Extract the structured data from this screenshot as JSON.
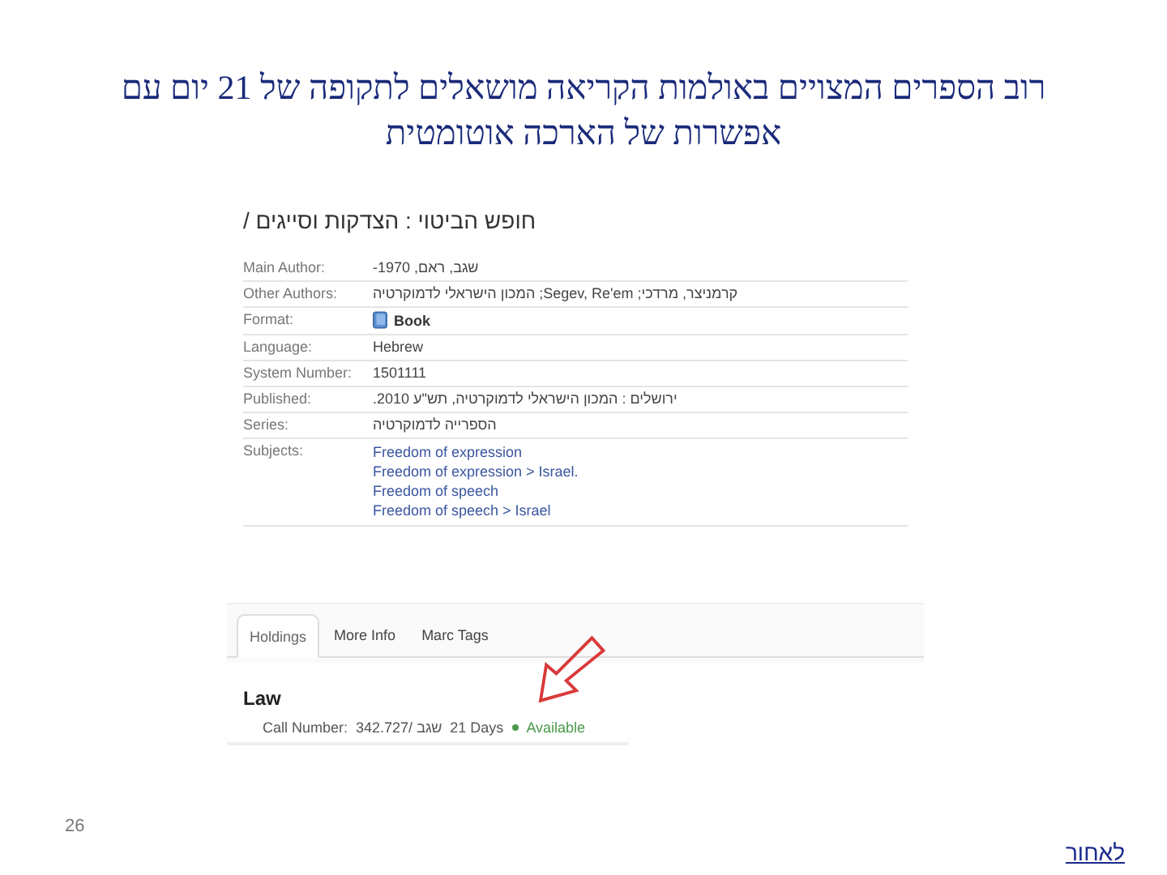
{
  "slide": {
    "title": "רוב הספרים המצויים באולמות הקריאה מושאלים לתקופה של 21 יום עם אפשרות של הארכה אוטומטית",
    "page_number": "26",
    "back_link": "לאחור"
  },
  "record": {
    "title": "חופש הביטוי : הצדקות וסייגים /",
    "fields": [
      {
        "label": "Main Author:",
        "kind": "text",
        "values": [
          "שגב, ראם, 1970-"
        ]
      },
      {
        "label": "Other Authors:",
        "kind": "text",
        "values": [
          "קרמניצר, מרדכי; Segev, Re'em; המכון הישראלי לדמוקרטיה"
        ]
      },
      {
        "label": "Format:",
        "kind": "format",
        "values": [
          "Book"
        ]
      },
      {
        "label": "Language:",
        "kind": "text",
        "values": [
          "Hebrew"
        ]
      },
      {
        "label": "System Number:",
        "kind": "text",
        "values": [
          "1501111"
        ]
      },
      {
        "label": "Published:",
        "kind": "text",
        "values": [
          "ירושלים : המכון הישראלי לדמוקרטיה, תש\"ע 2010."
        ]
      },
      {
        "label": "Series:",
        "kind": "text",
        "values": [
          "הספרייה לדמוקרטיה"
        ]
      },
      {
        "label": "Subjects:",
        "kind": "links",
        "values": [
          "Freedom of expression",
          "Freedom of expression > Israel.",
          "Freedom of speech",
          "Freedom of speech > Israel"
        ]
      }
    ]
  },
  "holdings": {
    "tabs": [
      {
        "label": "Holdings",
        "selected": true
      },
      {
        "label": "More Info",
        "selected": false
      },
      {
        "label": "Marc Tags",
        "selected": false
      }
    ],
    "location": "Law",
    "items": [
      {
        "label": "Call Number:",
        "call_number": "342.727/ שגב",
        "loan_period": "21 Days",
        "status": "Available",
        "color": "#4a9a4a"
      }
    ]
  }
}
